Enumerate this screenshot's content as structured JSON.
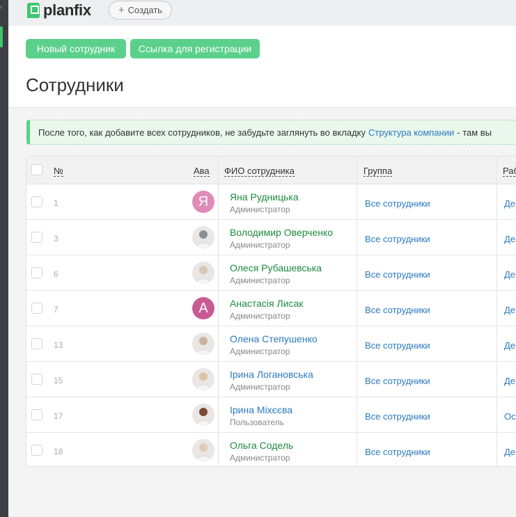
{
  "app": {
    "logo_text": "planfix",
    "create_label": "Создать"
  },
  "toolbar": {
    "new_employee": "Новый сотрудник",
    "reg_link": "Ссылка для регистрации"
  },
  "page_title": "Сотрудники",
  "notice": {
    "text_before": "После того, как добавите всех сотрудников, не забудьте заглянуть во вкладку",
    "link": "Структура компании",
    "text_after": "- там вы"
  },
  "table": {
    "columns": {
      "num": "№",
      "avatar": "Ава",
      "fio": "ФИО сотрудника",
      "group": "Группа",
      "work": "Раб"
    },
    "rows": [
      {
        "num": "1",
        "name": "Яна Рудницька",
        "role": "Администратор",
        "group": "Все сотрудники",
        "work": "Ден",
        "avatar": "Я"
      },
      {
        "num": "3",
        "name": "Володимир Оверченко",
        "role": "Администратор",
        "group": "Все сотрудники",
        "work": "Ден",
        "avatar": ""
      },
      {
        "num": "6",
        "name": "Олеся Рубашевська",
        "role": "Администратор",
        "group": "Все сотрудники",
        "work": "Ден",
        "avatar": ""
      },
      {
        "num": "7",
        "name": "Анастасія Лисак",
        "role": "Администратор",
        "group": "Все сотрудники",
        "work": "Ден",
        "avatar": "А"
      },
      {
        "num": "13",
        "name": "Олена Степушенко",
        "role": "Администратор",
        "group": "Все сотрудники",
        "work": "Ден",
        "avatar": ""
      },
      {
        "num": "15",
        "name": "Ірина Логановська",
        "role": "Администратор",
        "group": "Все сотрудники",
        "work": "Ден",
        "avatar": ""
      },
      {
        "num": "17",
        "name": "Ірина Міхєєва",
        "role": "Пользователь",
        "group": "Все сотрудники",
        "work": "Осо",
        "avatar": ""
      },
      {
        "num": "18",
        "name": "Ольга Содель",
        "role": "Администратор",
        "group": "Все сотрудники",
        "work": "Ден",
        "avatar": ""
      }
    ]
  },
  "colors": {
    "accent": "#5bd08b",
    "link": "#2b7bc0",
    "name": "#1c8a3e"
  }
}
